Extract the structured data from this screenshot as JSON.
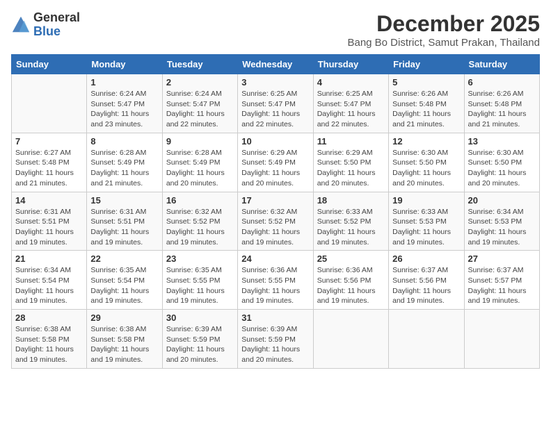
{
  "logo": {
    "general": "General",
    "blue": "Blue"
  },
  "title": "December 2025",
  "location": "Bang Bo District, Samut Prakan, Thailand",
  "days_of_week": [
    "Sunday",
    "Monday",
    "Tuesday",
    "Wednesday",
    "Thursday",
    "Friday",
    "Saturday"
  ],
  "weeks": [
    [
      {
        "day": "",
        "info": ""
      },
      {
        "day": "1",
        "info": "Sunrise: 6:24 AM\nSunset: 5:47 PM\nDaylight: 11 hours\nand 23 minutes."
      },
      {
        "day": "2",
        "info": "Sunrise: 6:24 AM\nSunset: 5:47 PM\nDaylight: 11 hours\nand 22 minutes."
      },
      {
        "day": "3",
        "info": "Sunrise: 6:25 AM\nSunset: 5:47 PM\nDaylight: 11 hours\nand 22 minutes."
      },
      {
        "day": "4",
        "info": "Sunrise: 6:25 AM\nSunset: 5:47 PM\nDaylight: 11 hours\nand 22 minutes."
      },
      {
        "day": "5",
        "info": "Sunrise: 6:26 AM\nSunset: 5:48 PM\nDaylight: 11 hours\nand 21 minutes."
      },
      {
        "day": "6",
        "info": "Sunrise: 6:26 AM\nSunset: 5:48 PM\nDaylight: 11 hours\nand 21 minutes."
      }
    ],
    [
      {
        "day": "7",
        "info": "Sunrise: 6:27 AM\nSunset: 5:48 PM\nDaylight: 11 hours\nand 21 minutes."
      },
      {
        "day": "8",
        "info": "Sunrise: 6:28 AM\nSunset: 5:49 PM\nDaylight: 11 hours\nand 21 minutes."
      },
      {
        "day": "9",
        "info": "Sunrise: 6:28 AM\nSunset: 5:49 PM\nDaylight: 11 hours\nand 20 minutes."
      },
      {
        "day": "10",
        "info": "Sunrise: 6:29 AM\nSunset: 5:49 PM\nDaylight: 11 hours\nand 20 minutes."
      },
      {
        "day": "11",
        "info": "Sunrise: 6:29 AM\nSunset: 5:50 PM\nDaylight: 11 hours\nand 20 minutes."
      },
      {
        "day": "12",
        "info": "Sunrise: 6:30 AM\nSunset: 5:50 PM\nDaylight: 11 hours\nand 20 minutes."
      },
      {
        "day": "13",
        "info": "Sunrise: 6:30 AM\nSunset: 5:50 PM\nDaylight: 11 hours\nand 20 minutes."
      }
    ],
    [
      {
        "day": "14",
        "info": "Sunrise: 6:31 AM\nSunset: 5:51 PM\nDaylight: 11 hours\nand 19 minutes."
      },
      {
        "day": "15",
        "info": "Sunrise: 6:31 AM\nSunset: 5:51 PM\nDaylight: 11 hours\nand 19 minutes."
      },
      {
        "day": "16",
        "info": "Sunrise: 6:32 AM\nSunset: 5:52 PM\nDaylight: 11 hours\nand 19 minutes."
      },
      {
        "day": "17",
        "info": "Sunrise: 6:32 AM\nSunset: 5:52 PM\nDaylight: 11 hours\nand 19 minutes."
      },
      {
        "day": "18",
        "info": "Sunrise: 6:33 AM\nSunset: 5:52 PM\nDaylight: 11 hours\nand 19 minutes."
      },
      {
        "day": "19",
        "info": "Sunrise: 6:33 AM\nSunset: 5:53 PM\nDaylight: 11 hours\nand 19 minutes."
      },
      {
        "day": "20",
        "info": "Sunrise: 6:34 AM\nSunset: 5:53 PM\nDaylight: 11 hours\nand 19 minutes."
      }
    ],
    [
      {
        "day": "21",
        "info": "Sunrise: 6:34 AM\nSunset: 5:54 PM\nDaylight: 11 hours\nand 19 minutes."
      },
      {
        "day": "22",
        "info": "Sunrise: 6:35 AM\nSunset: 5:54 PM\nDaylight: 11 hours\nand 19 minutes."
      },
      {
        "day": "23",
        "info": "Sunrise: 6:35 AM\nSunset: 5:55 PM\nDaylight: 11 hours\nand 19 minutes."
      },
      {
        "day": "24",
        "info": "Sunrise: 6:36 AM\nSunset: 5:55 PM\nDaylight: 11 hours\nand 19 minutes."
      },
      {
        "day": "25",
        "info": "Sunrise: 6:36 AM\nSunset: 5:56 PM\nDaylight: 11 hours\nand 19 minutes."
      },
      {
        "day": "26",
        "info": "Sunrise: 6:37 AM\nSunset: 5:56 PM\nDaylight: 11 hours\nand 19 minutes."
      },
      {
        "day": "27",
        "info": "Sunrise: 6:37 AM\nSunset: 5:57 PM\nDaylight: 11 hours\nand 19 minutes."
      }
    ],
    [
      {
        "day": "28",
        "info": "Sunrise: 6:38 AM\nSunset: 5:58 PM\nDaylight: 11 hours\nand 19 minutes."
      },
      {
        "day": "29",
        "info": "Sunrise: 6:38 AM\nSunset: 5:58 PM\nDaylight: 11 hours\nand 19 minutes."
      },
      {
        "day": "30",
        "info": "Sunrise: 6:39 AM\nSunset: 5:59 PM\nDaylight: 11 hours\nand 20 minutes."
      },
      {
        "day": "31",
        "info": "Sunrise: 6:39 AM\nSunset: 5:59 PM\nDaylight: 11 hours\nand 20 minutes."
      },
      {
        "day": "",
        "info": ""
      },
      {
        "day": "",
        "info": ""
      },
      {
        "day": "",
        "info": ""
      }
    ]
  ]
}
